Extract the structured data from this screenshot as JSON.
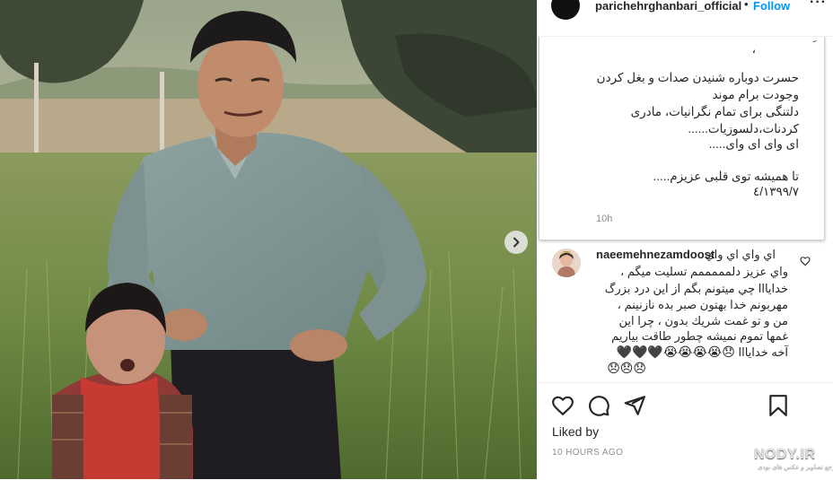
{
  "post": {
    "username": "parichehrghanbari_official",
    "separator": "•",
    "follow_label": "Follow",
    "more_label": "···",
    "image_alt": "Vintage family photo of a man and a little girl standing in a green field"
  },
  "caption": {
    "partial_top": "ِ",
    "dot_line": "،",
    "lines": [
      "حسرت دوباره شنیدن صدات و بغل کردن",
      "وجودت برام موند",
      "دلتنگی برای تمام نگرانیات، مادری",
      "کردنات،دلسوزیات......",
      "ای وای ای وای.....",
      "",
      "تا همیشه توی قلبی عزیزم.....",
      "۱۳۹۹/۷/٤"
    ],
    "time": "10h"
  },
  "comment": {
    "username": "naeemehnezamdoost",
    "lines": [
      "اي واي اي واي",
      "واي عزيز دلمممممم تسليت ميگم ،",
      "خدايااا چي ميتونم بگم از اين درد بزرگ",
      "مهربونم خدا بهتون صبر بده نازنينم ،",
      "من و تو غمت شريك بدون ، چرا اين",
      "غمها تموم نميشه چطور طاقت بياريم"
    ],
    "last_text": "آخه خدايااا",
    "emoji_line1": "😞😭😭😭😭🖤🖤🖤",
    "emoji_line2": "😞😞😞"
  },
  "actions": {
    "liked_by": "Liked by",
    "age": "10 HOURS AGO"
  },
  "watermark": {
    "text": "NODY.IR",
    "sub": "مرجع تصاویر و عکس های نودی"
  },
  "icons": {
    "next": "chevron-right-icon",
    "like": "heart-icon",
    "comment": "comment-bubble-icon",
    "share": "paper-plane-icon",
    "save": "bookmark-icon"
  },
  "colors": {
    "accent": "#0095f6",
    "text": "#262626",
    "muted": "#8e8e8e",
    "border": "#efefef"
  }
}
